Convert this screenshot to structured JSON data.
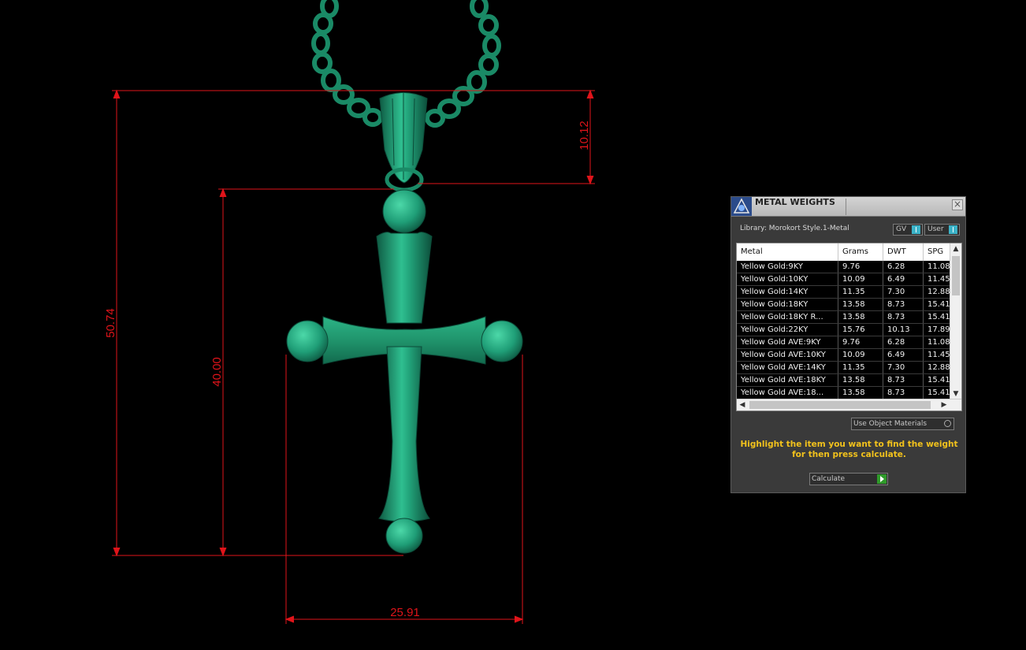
{
  "dimensions": {
    "total_height": "50.74",
    "cross_height": "40.00",
    "bail_height": "10.12",
    "width": "25.91"
  },
  "colors": {
    "dimension_lines": "#e0141a",
    "model": "#1f9e77",
    "hint_text": "#f2c21c"
  },
  "panel": {
    "title": "METAL WEIGHTS",
    "close_label": "×",
    "library": "Library: Morokort Style.1-Metal",
    "toggle_gv": "GV",
    "toggle_user": "User",
    "columns": [
      "Metal",
      "Grams",
      "DWT",
      "SPG"
    ],
    "rows": [
      [
        "Yellow Gold:9KY",
        "9.76",
        "6.28",
        "11.08"
      ],
      [
        "Yellow Gold:10KY",
        "10.09",
        "6.49",
        "11.45"
      ],
      [
        "Yellow Gold:14KY",
        "11.35",
        "7.30",
        "12.88"
      ],
      [
        "Yellow Gold:18KY",
        "13.58",
        "8.73",
        "15.41"
      ],
      [
        "Yellow Gold:18KY R...",
        "13.58",
        "8.73",
        "15.41"
      ],
      [
        "Yellow Gold:22KY",
        "15.76",
        "10.13",
        "17.89"
      ],
      [
        "Yellow Gold AVE:9KY",
        "9.76",
        "6.28",
        "11.08"
      ],
      [
        "Yellow Gold AVE:10KY",
        "10.09",
        "6.49",
        "11.45"
      ],
      [
        "Yellow Gold AVE:14KY",
        "11.35",
        "7.30",
        "12.88"
      ],
      [
        "Yellow Gold AVE:18KY",
        "13.58",
        "8.73",
        "15.41"
      ],
      [
        "Yellow Gold AVE:18...",
        "13.58",
        "8.73",
        "15.41"
      ]
    ],
    "use_object_materials": "Use Object Materials",
    "hint": "Highlight the item you want to find the weight for then press calculate.",
    "calculate": "Calculate"
  }
}
